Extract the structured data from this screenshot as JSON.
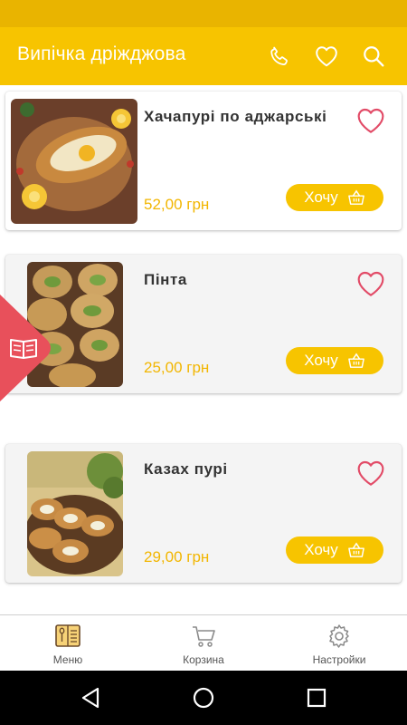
{
  "appbar": {
    "title": "Випічка дріжджова",
    "icons": [
      "phone-icon",
      "heart-icon",
      "search-icon"
    ]
  },
  "products": [
    {
      "name": "Хачапурі по аджарські",
      "price": "52,00 грн",
      "action": "Хочу"
    },
    {
      "name": "Пінта",
      "price": "25,00 грн",
      "action": "Хочу"
    },
    {
      "name": "Казах пурі",
      "price": "29,00 грн",
      "action": "Хочу"
    }
  ],
  "bottom_nav": {
    "items": [
      {
        "label": "Меню",
        "icon": "menu-book-icon",
        "active": true
      },
      {
        "label": "Корзина",
        "icon": "cart-icon"
      },
      {
        "label": "Настройки",
        "icon": "gear-icon"
      }
    ]
  },
  "colors": {
    "accent": "#f7c400",
    "status_bar": "#e9b400",
    "price": "#f2b600",
    "heart": "#e24b67",
    "side_tab": "#e8505b"
  }
}
